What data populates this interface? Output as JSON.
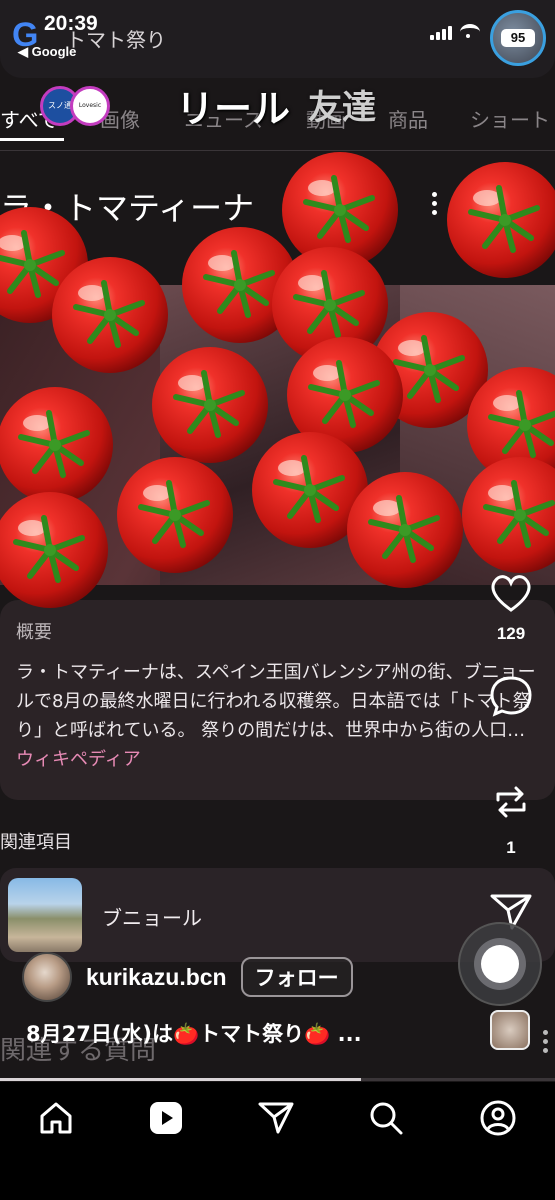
{
  "status": {
    "time": "20:39",
    "back_label": "◀ Google",
    "battery": "95"
  },
  "google": {
    "query": "トマト祭り",
    "tabs": [
      {
        "label": "すべて",
        "active": true
      },
      {
        "label": "画像"
      },
      {
        "label": "ニュース"
      },
      {
        "label": "動画"
      },
      {
        "label": "商品"
      },
      {
        "label": "ショート"
      }
    ],
    "knowledge_title": "ラ・トマティーナ",
    "overview": {
      "label": "概要",
      "text": "ラ・トマティーナは、スペイン王国バレンシア州の街、ブニョールで8月の最終水曜日に行われる収穫祭。日本語では「トマト祭り」と呼ばれている。 祭りの間だけは、世界中から街の人口…",
      "link": "ウィキペディア"
    },
    "related": {
      "heading": "関連項目",
      "items": [
        {
          "label": "ブニョール"
        }
      ]
    },
    "faq_heading": "関連する質問"
  },
  "reels": {
    "title": "リール",
    "friends_tab": "友達",
    "story_a_label": "スノ通",
    "story_b_label": "Lovesic LIVE Babylon",
    "actions": {
      "likes": "129",
      "comments": "",
      "reposts": "1",
      "shares": ""
    },
    "account": {
      "username": "kurikazu.bcn",
      "follow_label": "フォロー"
    },
    "caption": "8月27日(水)は🍅トマト祭り🍅 ...",
    "progress": 0.65
  },
  "nav": {
    "items": [
      "home-icon",
      "reels-icon",
      "send-icon",
      "search-icon",
      "profile-icon"
    ]
  },
  "colors": {
    "accent_link": "#e78ab5",
    "tomato": "#d8231e",
    "story_ring": "#c33cbf"
  }
}
